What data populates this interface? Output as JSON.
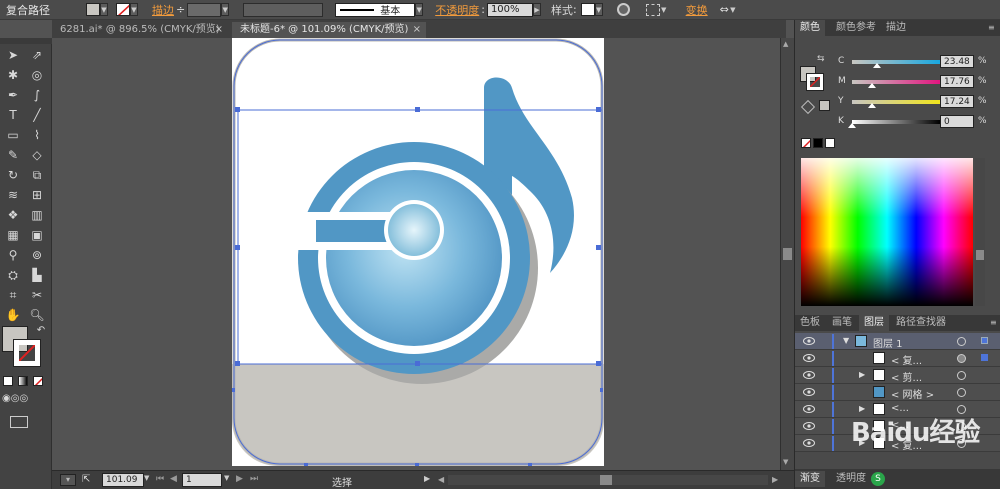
{
  "control_bar": {
    "object_type": "复合路径",
    "stroke_label": "描边",
    "stroke_profile": "基本",
    "opacity_label": "不透明度",
    "opacity_value": "100%",
    "style_label": "样式",
    "transform_label": "变换"
  },
  "tabs": [
    {
      "label": "6281.ai* @ 896.5% (CMYK/预览)",
      "active": false
    },
    {
      "label": "未标题-6* @ 101.09% (CMYK/预览)",
      "active": true
    }
  ],
  "status_bar": {
    "zoom": "101.09",
    "page": "1",
    "tool": "选择"
  },
  "color_panel": {
    "tabs": [
      "颜色",
      "颜色参考",
      "描边"
    ],
    "channels": [
      {
        "name": "C",
        "value": "23.48",
        "unit": "%",
        "level": 0.2348
      },
      {
        "name": "M",
        "value": "17.76",
        "unit": "%",
        "level": 0.1776
      },
      {
        "name": "Y",
        "value": "17.24",
        "unit": "%",
        "level": 0.1724
      },
      {
        "name": "K",
        "value": "0",
        "unit": "%",
        "level": 0
      }
    ]
  },
  "layers_panel": {
    "tabs": [
      "色板",
      "画笔",
      "图层",
      "路径查找器"
    ],
    "items": [
      {
        "name": "图层 1",
        "kind": "layer"
      },
      {
        "name": "< 复...",
        "kind": "sub"
      },
      {
        "name": "< 剪...",
        "kind": "sub"
      },
      {
        "name": "< 网格 >",
        "kind": "sub"
      },
      {
        "name": "<...",
        "kind": "sub"
      },
      {
        "name": "<...",
        "kind": "sub"
      },
      {
        "name": "< 复...",
        "kind": "sub"
      }
    ]
  },
  "bottom_panel_tabs": [
    "渐变",
    "透明度"
  ],
  "watermark": "Baidu经验",
  "colors": {
    "music_blue": "#5197c5",
    "gray_band": "#c8c6c1",
    "selection": "#4a6cd6"
  }
}
